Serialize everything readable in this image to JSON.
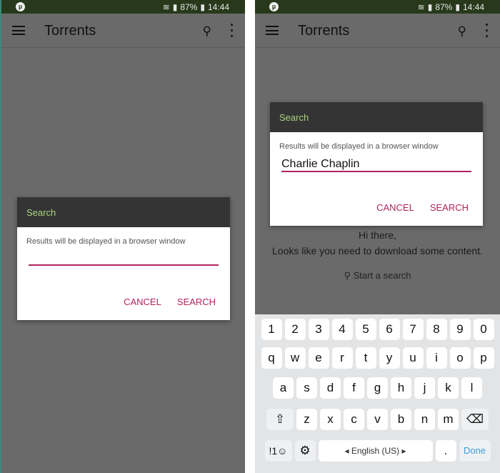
{
  "status": {
    "battery": "87%",
    "time": "14:44",
    "app_logo": "utorrent-icon"
  },
  "appbar": {
    "title": "Torrents"
  },
  "empty_state": {
    "line1": "Hi there,",
    "line2": "Looks like you need to download some content.",
    "action": "Start a search"
  },
  "dialog": {
    "title": "Search",
    "message": "Results will be displayed in a browser window",
    "left_value": "",
    "right_value": "Charlie Chaplin",
    "cancel": "CANCEL",
    "search": "SEARCH"
  },
  "colors": {
    "accent": "#b0245e",
    "dialog_title": "#a9d67f",
    "status_bar": "#27391a"
  },
  "keyboard": {
    "rows": [
      [
        "1",
        "2",
        "3",
        "4",
        "5",
        "6",
        "7",
        "8",
        "9",
        "0"
      ],
      [
        "q",
        "w",
        "e",
        "r",
        "t",
        "y",
        "u",
        "i",
        "o",
        "p"
      ],
      [
        "a",
        "s",
        "d",
        "f",
        "g",
        "h",
        "j",
        "k",
        "l"
      ],
      [
        "⇧",
        "z",
        "x",
        "c",
        "v",
        "b",
        "n",
        "m",
        "⌫"
      ]
    ],
    "symbols": "!1☺",
    "settings": "⚙",
    "space": "English (US)",
    "period": ".",
    "done": "Done"
  }
}
